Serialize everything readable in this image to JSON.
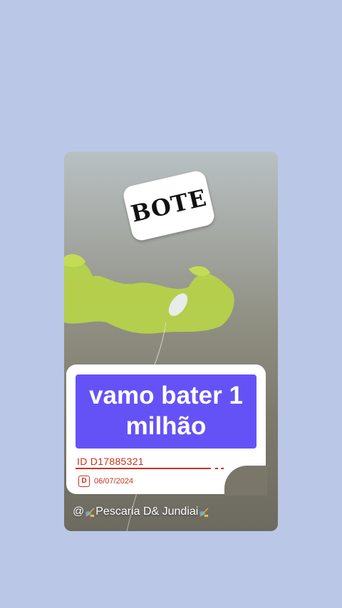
{
  "sticker": {
    "text": "BOTE"
  },
  "headline": {
    "line1": "vamo bater 1",
    "line2": "milhão"
  },
  "stamp": {
    "id": "ID  D17885321",
    "date": "06/07/2024",
    "icon": "D"
  },
  "footer": {
    "prefix": "@",
    "text": "Pescaria D& Jundiai"
  },
  "icons": [
    "fishing-rod-icon",
    "fishing-rod-icon"
  ],
  "colors": {
    "background": "#bac7e6",
    "headline_bg": "#6552f6",
    "stamp": "#c8321e",
    "algae": "#b9d44a"
  }
}
